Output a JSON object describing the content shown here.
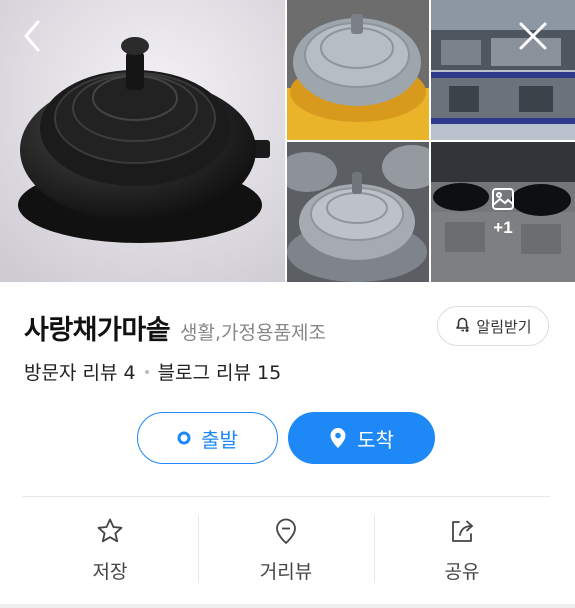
{
  "header": {
    "back_icon": "chevron-left-icon",
    "close_icon": "close-icon"
  },
  "gallery": {
    "more_count": "+1",
    "more_icon": "image-icon"
  },
  "place": {
    "name": "사랑채가마솥",
    "category": "생활,가정용품제조"
  },
  "alarm": {
    "label": "알림받기",
    "icon": "bell-plus-icon"
  },
  "reviews": {
    "visitor_label": "방문자 리뷰 4",
    "blog_label": "블로그 리뷰 15"
  },
  "route": {
    "depart_label": "출발",
    "arrive_label": "도착"
  },
  "actions": [
    {
      "label": "저장",
      "icon": "star-icon"
    },
    {
      "label": "거리뷰",
      "icon": "street-view-icon"
    },
    {
      "label": "공유",
      "icon": "share-icon"
    }
  ],
  "colors": {
    "accent": "#1e88f7",
    "muted": "#888888",
    "divider": "#e8e8e8"
  }
}
